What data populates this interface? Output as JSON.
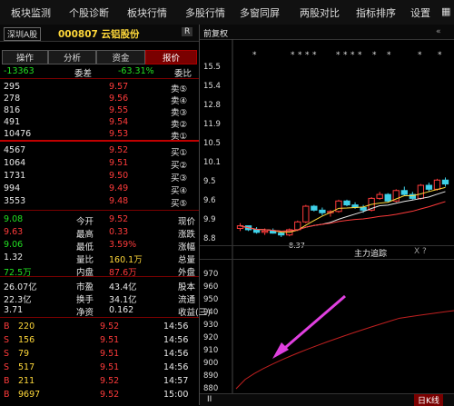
{
  "menu": [
    "板块监测",
    "个股诊断",
    "板块行情",
    "多股行情",
    "多窗同屏",
    "两股对比",
    "指标排序",
    "设置"
  ],
  "stock": {
    "title": "000807 云铝股份",
    "badge": "R",
    "market_btn": "深圳A股"
  },
  "tabs": [
    "报价",
    "资金",
    "分析",
    "操作"
  ],
  "weibi": {
    "label": "委比",
    "value": "-63.31%",
    "label2": "委差",
    "value2": "-13363"
  },
  "sell_orders": [
    {
      "label": "卖⑤",
      "price": "9.57",
      "vol": "295"
    },
    {
      "label": "卖④",
      "price": "9.56",
      "vol": "278"
    },
    {
      "label": "卖③",
      "price": "9.55",
      "vol": "816"
    },
    {
      "label": "卖②",
      "price": "9.54",
      "vol": "491"
    },
    {
      "label": "卖①",
      "price": "9.53",
      "vol": "10476"
    }
  ],
  "buy_orders": [
    {
      "label": "买①",
      "price": "9.52",
      "vol": "4567"
    },
    {
      "label": "买②",
      "price": "9.51",
      "vol": "1064"
    },
    {
      "label": "买③",
      "price": "9.50",
      "vol": "1731"
    },
    {
      "label": "买④",
      "price": "9.49",
      "vol": "994"
    },
    {
      "label": "买⑤",
      "price": "9.48",
      "vol": "3553"
    }
  ],
  "stats_left": [
    {
      "label": "现价",
      "value": "9.52",
      "color": "#ff3b3b"
    },
    {
      "label": "涨跌",
      "value": "0.33",
      "color": "#ff3b3b"
    },
    {
      "label": "涨幅",
      "value": "3.59%",
      "color": "#ff3b3b"
    },
    {
      "label": "总量",
      "value": "160.1万",
      "color": "#ffd83a"
    },
    {
      "label": "外盘",
      "value": "87.6万",
      "color": "#ff3b3b"
    }
  ],
  "stats_right": [
    {
      "label": "今开",
      "value": "9.08",
      "color": "#22e022"
    },
    {
      "label": "最高",
      "value": "9.63",
      "color": "#ff3b3b"
    },
    {
      "label": "最低",
      "value": "9.06",
      "color": "#22e022"
    },
    {
      "label": "量比",
      "value": "1.32",
      "color": "#e8e8e8"
    },
    {
      "label": "内盘",
      "value": "72.5万",
      "color": "#22e022"
    }
  ],
  "stats2_left": [
    {
      "label": "股本",
      "value": "43.4亿"
    },
    {
      "label": "流通",
      "value": "34.1亿"
    },
    {
      "label": "收益(三)",
      "value": "0.162"
    }
  ],
  "stats2_right": [
    {
      "label": "市盈",
      "value": "26.07亿"
    },
    {
      "label": "换手",
      "value": "22.3亿"
    },
    {
      "label": "净资",
      "value": "3.71"
    }
  ],
  "ticks": [
    {
      "time": "14:56",
      "price": "9.52",
      "vol": "220",
      "flag": "B"
    },
    {
      "time": "14:56",
      "price": "9.51",
      "vol": "156",
      "flag": "S"
    },
    {
      "time": "14:56",
      "price": "9.51",
      "vol": "79",
      "flag": "S"
    },
    {
      "time": "14:56",
      "price": "9.51",
      "vol": "517",
      "flag": "S"
    },
    {
      "time": "14:57",
      "price": "9.52",
      "vol": "211",
      "flag": "B"
    },
    {
      "time": "15:00",
      "price": "9.52",
      "vol": "9697",
      "flag": "B"
    }
  ],
  "chart": {
    "tab": "K线",
    "top_label": "前复权",
    "indicator_title": "主力追踪",
    "indicator_btns": "X ?",
    "min_label": "8.37",
    "y_ticks_top": [
      "15.5",
      "15.4",
      "12.8",
      "11.9",
      "10.5",
      "10.1",
      "9.5",
      "9.6",
      "9.9",
      "8.8"
    ],
    "y_ticks_bottom": [
      "970",
      "960",
      "950",
      "940",
      "930",
      "920",
      "910",
      "900",
      "890",
      "880"
    ],
    "bottom_tabs": [
      "日K线",
      "II"
    ]
  },
  "chart_data": {
    "type": "candlestick",
    "title": "",
    "ylim": [
      8.3,
      15.6
    ],
    "candles": [
      [
        8.7,
        8.9,
        8.6,
        8.8
      ],
      [
        8.8,
        8.8,
        8.6,
        8.65
      ],
      [
        8.65,
        8.75,
        8.5,
        8.55
      ],
      [
        8.55,
        8.7,
        8.45,
        8.6
      ],
      [
        8.6,
        8.7,
        8.5,
        8.52
      ],
      [
        8.52,
        8.6,
        8.37,
        8.45
      ],
      [
        8.45,
        8.7,
        8.4,
        8.65
      ],
      [
        8.65,
        9.0,
        8.6,
        8.95
      ],
      [
        8.95,
        9.6,
        8.9,
        9.55
      ],
      [
        9.55,
        9.6,
        9.35,
        9.4
      ],
      [
        9.4,
        9.5,
        9.2,
        9.3
      ],
      [
        9.3,
        9.4,
        9.15,
        9.35
      ],
      [
        9.35,
        9.8,
        9.3,
        9.75
      ],
      [
        9.75,
        9.8,
        9.55,
        9.6
      ],
      [
        9.6,
        9.7,
        9.45,
        9.5
      ],
      [
        9.5,
        9.6,
        9.3,
        9.4
      ],
      [
        9.4,
        9.9,
        9.35,
        9.85
      ],
      [
        9.85,
        10.1,
        9.8,
        10.0
      ],
      [
        10.0,
        10.05,
        9.7,
        9.75
      ],
      [
        9.75,
        10.2,
        9.7,
        10.15
      ],
      [
        10.15,
        10.3,
        9.95,
        10.0
      ],
      [
        10.0,
        10.1,
        9.8,
        9.85
      ],
      [
        9.85,
        10.4,
        9.8,
        10.35
      ],
      [
        10.35,
        10.45,
        10.1,
        10.2
      ],
      [
        10.2,
        10.6,
        10.15,
        10.55
      ],
      [
        10.55,
        10.65,
        10.3,
        10.4
      ]
    ]
  }
}
